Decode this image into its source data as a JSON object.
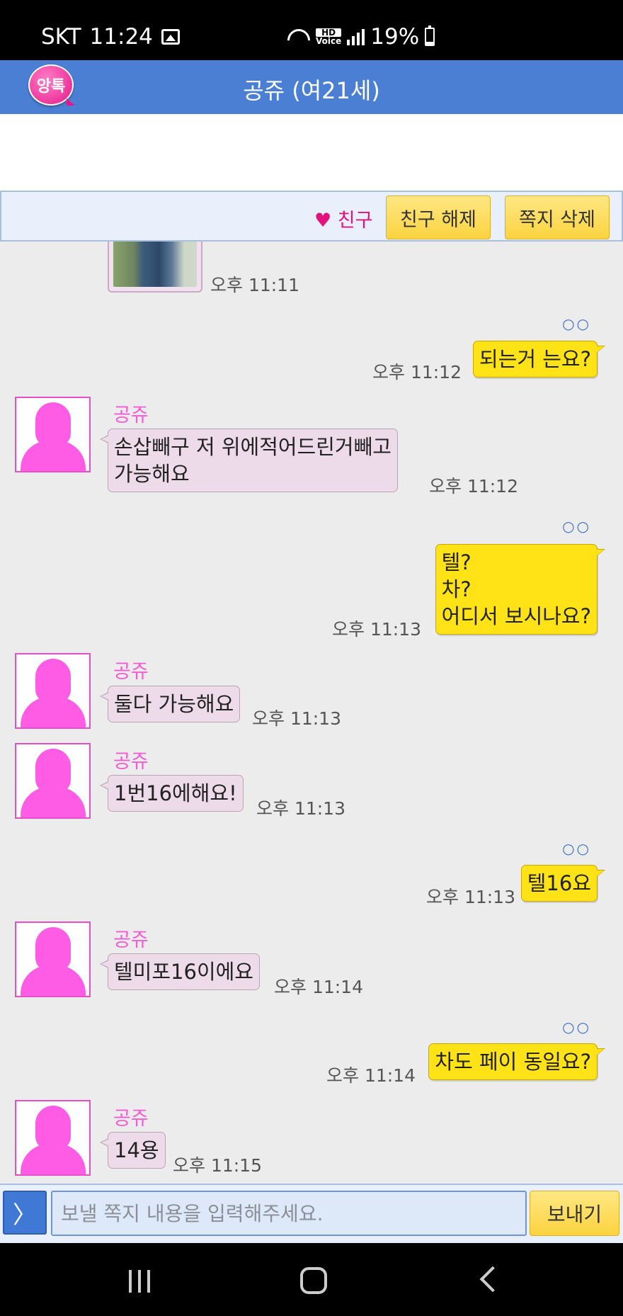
{
  "status_bar": {
    "carrier": "SKT",
    "time": "11:24",
    "battery": "19%",
    "icons": [
      "image-icon",
      "wifi-icon",
      "hd-voice-icon",
      "signal-icon",
      "battery-icon"
    ],
    "hd_label": "HD",
    "voice_label": "Voice"
  },
  "header": {
    "logo_text": "앙톡",
    "title": "공쥬 (여21세)",
    "color": "#4a7fd4"
  },
  "toolbar": {
    "friend_label": "♥ 친구",
    "unfriend_button": "친구 해제",
    "delete_button": "쪽지 삭제"
  },
  "messages": [
    {
      "dir": "in",
      "photo": true,
      "time": "오후 11:11"
    },
    {
      "dir": "out",
      "read": "○○",
      "text": "되는거 는요?",
      "time": "오후 11:12"
    },
    {
      "dir": "in",
      "sender": "공쥬",
      "text": "손삽빼구 저 위에적어드린거빼고\n가능해요",
      "time": "오후 11:12"
    },
    {
      "dir": "out",
      "read": "○○",
      "text": "텔?\n차?\n어디서 보시나요?",
      "time": "오후 11:13"
    },
    {
      "dir": "in",
      "sender": "공쥬",
      "text": "둘다 가능해요",
      "time": "오후 11:13"
    },
    {
      "dir": "in",
      "sender": "공쥬",
      "text": "1번16에해요!",
      "time": "오후 11:13"
    },
    {
      "dir": "out",
      "read": "○○",
      "text": "텔16요",
      "time": "오후 11:13"
    },
    {
      "dir": "in",
      "sender": "공쥬",
      "text": "텔미포16이에요",
      "time": "오후 11:14"
    },
    {
      "dir": "out",
      "read": "○○",
      "text": "차도 페이 동일요?",
      "time": "오후 11:14"
    },
    {
      "dir": "in",
      "sender": "공쥬",
      "text": "14용",
      "time": "오후 11:15"
    }
  ],
  "input": {
    "expand_glyph": "〉",
    "placeholder": "보낼 쪽지 내용을 입력해주세요.",
    "value": "",
    "send_button": "보내기"
  }
}
